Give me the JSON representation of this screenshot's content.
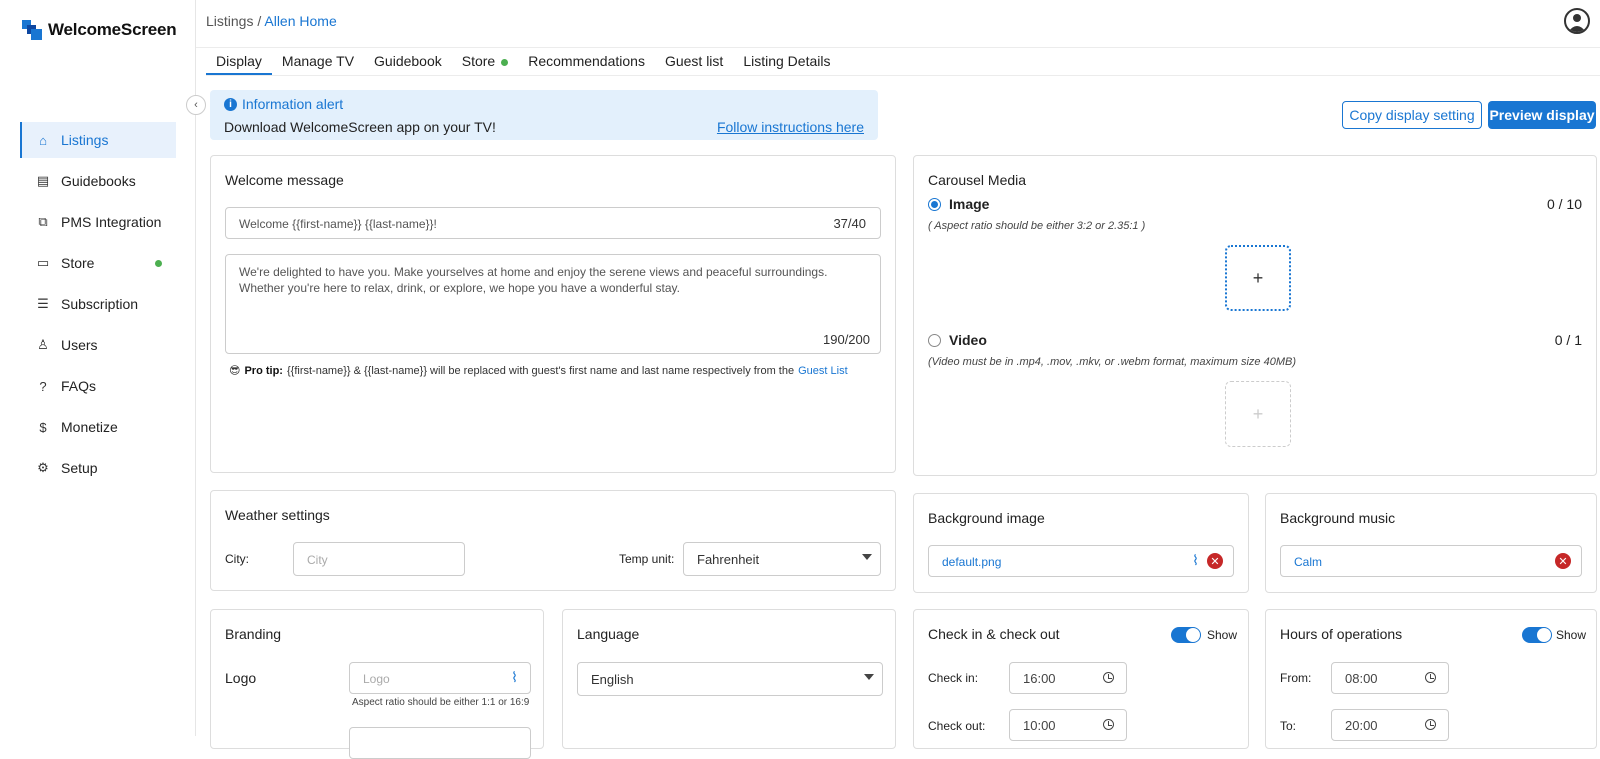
{
  "app": {
    "name": "WelcomeScreen"
  },
  "sidebar": {
    "items": [
      {
        "label": "Listings",
        "icon": "home-icon"
      },
      {
        "label": "Guidebooks",
        "icon": "book-icon"
      },
      {
        "label": "PMS Integration",
        "icon": "puzzle-icon"
      },
      {
        "label": "Store",
        "icon": "store-icon"
      },
      {
        "label": "Subscription",
        "icon": "subscription-icon"
      },
      {
        "label": "Users",
        "icon": "users-icon"
      },
      {
        "label": "FAQs",
        "icon": "question-icon"
      },
      {
        "label": "Monetize",
        "icon": "dollar-icon"
      },
      {
        "label": "Setup",
        "icon": "gear-icon"
      }
    ]
  },
  "breadcrumb": {
    "root": "Listings",
    "separator": "/",
    "current": "Allen Home"
  },
  "tabs": [
    "Display",
    "Manage TV",
    "Guidebook",
    "Store",
    "Recommendations",
    "Guest list",
    "Listing Details"
  ],
  "alert": {
    "title": "Information alert",
    "body": "Download WelcomeScreen app on your TV!",
    "link": "Follow instructions here"
  },
  "actions": {
    "copy": "Copy display setting",
    "preview": "Preview display"
  },
  "welcome": {
    "title": "Welcome message",
    "headline": "Welcome {{first-name}} {{last-name}}!",
    "headline_count": "37/40",
    "body": "We're delighted to have you. Make yourselves at home and enjoy the serene views and peaceful surroundings. Whether you're here to relax, drink, or explore, we hope you have a wonderful stay.",
    "body_count": "190/200",
    "tip_emoji": "😎",
    "tip_label": "Pro tip:",
    "tip_text": "{{first-name}} & {{last-name}} will be replaced with guest's first name and last name respectively from the",
    "tip_link": "Guest List"
  },
  "carousel": {
    "title": "Carousel Media",
    "image_label": "Image",
    "image_count": "0 / 10",
    "image_hint": "( Aspect ratio should be either 3:2 or 2.35:1 )",
    "video_label": "Video",
    "video_count": "0 / 1",
    "video_hint": "(Video must be in .mp4, .mov, .mkv, or .webm format, maximum size 40MB)",
    "plus": "+"
  },
  "weather": {
    "title": "Weather settings",
    "city_label": "City:",
    "city_placeholder": "City",
    "temp_label": "Temp unit:",
    "temp_value": "Fahrenheit"
  },
  "background_image": {
    "title": "Background image",
    "value": "default.png"
  },
  "background_music": {
    "title": "Background music",
    "value": "Calm"
  },
  "branding": {
    "title": "Branding",
    "logo_label": "Logo",
    "logo_placeholder": "Logo",
    "logo_hint": "Aspect ratio should be either 1:1 or 16:9"
  },
  "language": {
    "title": "Language",
    "value": "English"
  },
  "checkin": {
    "title": "Check in & check out",
    "show": "Show",
    "in_label": "Check in:",
    "in_value": "16:00",
    "out_label": "Check out:",
    "out_value": "10:00"
  },
  "hours": {
    "title": "Hours of operations",
    "show": "Show",
    "from_label": "From:",
    "from_value": "08:00",
    "to_label": "To:",
    "to_value": "20:00"
  },
  "colors": {
    "accent": "#1976d2",
    "status_green": "#4caf50",
    "danger": "#c62828"
  }
}
